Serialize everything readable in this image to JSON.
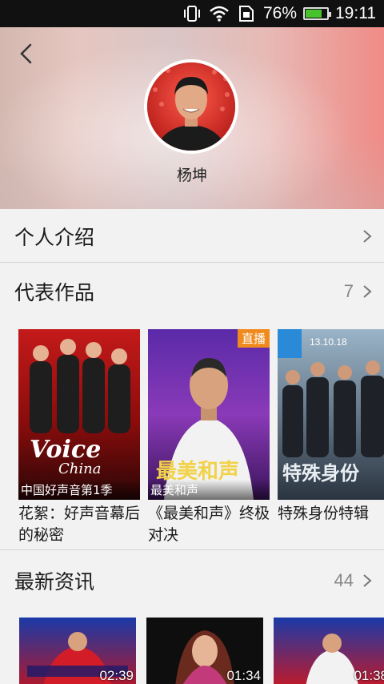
{
  "status_bar": {
    "battery_percent": "76%",
    "battery_level": 0.76,
    "time": "19:11",
    "icons": [
      "vibrate-icon",
      "wifi-icon",
      "sim-icon",
      "battery-icon"
    ]
  },
  "header": {
    "artist_name": "杨坤",
    "back_icon": "back-arrow-icon"
  },
  "sections": {
    "intro": {
      "title": "个人介绍"
    },
    "works": {
      "title": "代表作品",
      "count": "7"
    },
    "news": {
      "title": "最新资讯",
      "count": "44"
    }
  },
  "works": [
    {
      "caption": "中国好声音第1季",
      "title": "花絮：好声音幕后的秘密"
    },
    {
      "caption": "最美和声",
      "title": "《最美和声》终极对决",
      "badge": "直播"
    },
    {
      "caption": "",
      "title": "特殊身份特辑"
    }
  ],
  "news": [
    {
      "duration": "02:39"
    },
    {
      "duration": "01:34"
    },
    {
      "duration": "01:38"
    }
  ],
  "colors": {
    "accent_red": "#d8242a",
    "background": "#f2f2f2",
    "divider": "#d3d3d3"
  }
}
